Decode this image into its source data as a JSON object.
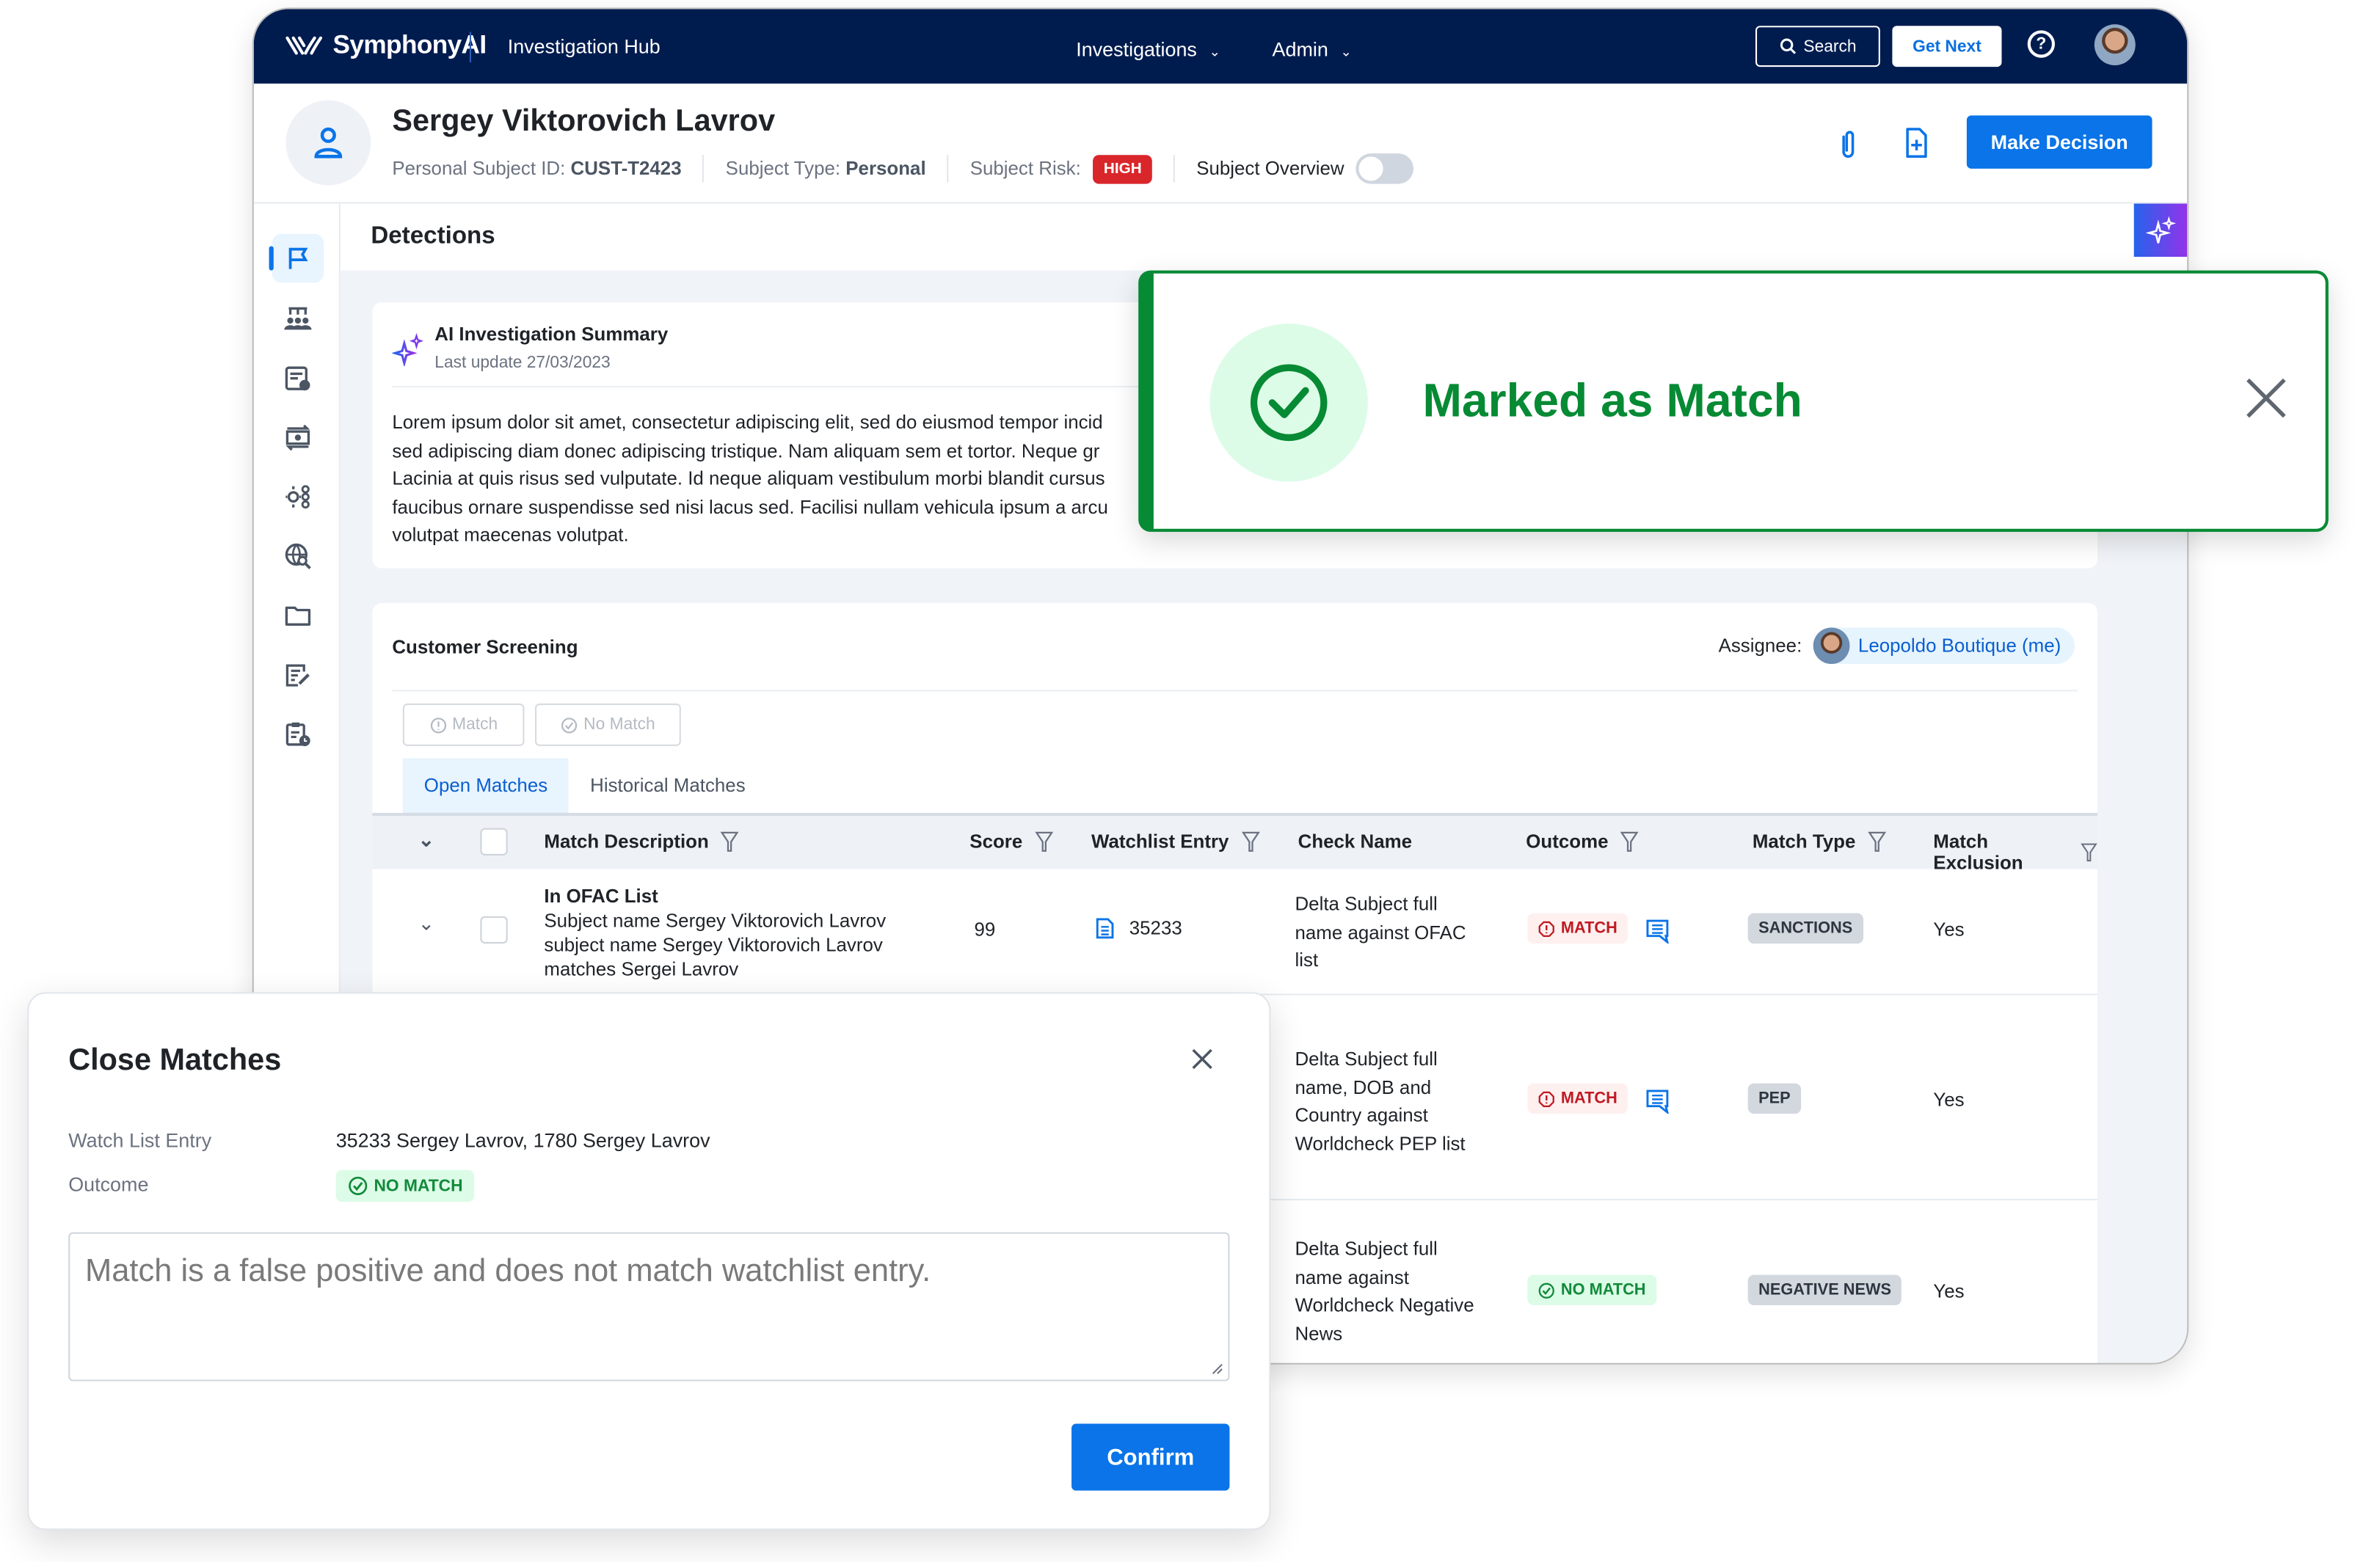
{
  "topbar": {
    "brand": "SymphonyAI",
    "app_name": "Investigation Hub",
    "nav": [
      {
        "label": "Investigations",
        "icon": "chevron-down-icon"
      },
      {
        "label": "Admin",
        "icon": "chevron-down-icon"
      }
    ],
    "search_label": "Search",
    "get_next_label": "Get Next",
    "help_icon": "help-circle-icon",
    "avatar_icon": "user-avatar"
  },
  "subject": {
    "name": "Sergey Viktorovich Lavrov",
    "id_label": "Personal Subject ID:",
    "id_value": "CUST-T2423",
    "type_label": "Subject Type:",
    "type_value": "Personal",
    "risk_label": "Subject Risk:",
    "risk_value": "HIGH",
    "overview_label": "Subject Overview",
    "overview_toggle_on": false,
    "make_decision_label": "Make Decision",
    "colors": {
      "risk_high": "#d9262b",
      "primary": "#0a74e8",
      "topbar": "#001c4f"
    }
  },
  "sidebar": {
    "items": [
      {
        "icon": "flag-icon",
        "active": true
      },
      {
        "icon": "team-icon",
        "active": false
      },
      {
        "icon": "document-info-icon",
        "active": false
      },
      {
        "icon": "transactions-icon",
        "active": false
      },
      {
        "icon": "settings-network-icon",
        "active": false
      },
      {
        "icon": "globe-search-icon",
        "active": false
      },
      {
        "icon": "folder-icon",
        "active": false
      },
      {
        "icon": "notes-edit-icon",
        "active": false
      },
      {
        "icon": "clipboard-clock-icon",
        "active": false
      }
    ]
  },
  "detections": {
    "title": "Detections",
    "ai_summary": {
      "title": "AI Investigation Summary",
      "last_update": "Last update 27/03/2023",
      "body_lines": [
        "Lorem ipsum dolor sit amet, consectetur adipiscing elit, sed do eiusmod tempor incid",
        "sed adipiscing diam donec adipiscing tristique. Nam aliquam sem et tortor. Neque gr",
        "Lacinia at quis risus sed vulputate. Id neque aliquam vestibulum morbi blandit cursus",
        "faucibus ornare suspendisse sed nisi lacus sed. Facilisi nullam vehicula ipsum a arcu",
        "volutpat maecenas volutpat."
      ]
    }
  },
  "screening": {
    "title": "Customer Screening",
    "assignee_label": "Assignee:",
    "assignee_name": "Leopoldo Boutique (me)",
    "action_buttons": [
      {
        "label": "Match",
        "icon": "alert-circle-icon",
        "disabled": true
      },
      {
        "label": "No Match",
        "icon": "check-circle-icon",
        "disabled": true
      }
    ],
    "tabs": [
      {
        "label": "Open Matches",
        "active": true
      },
      {
        "label": "Historical Matches",
        "active": false
      }
    ],
    "columns": [
      "Match Description",
      "Score",
      "Watchlist Entry",
      "Check Name",
      "Outcome",
      "Match Type",
      "Match Exclusion"
    ],
    "rows": [
      {
        "description_title": "In OFAC List",
        "description_lines": [
          "Subject name Sergey Viktorovich Lavrov",
          "subject name Sergey Viktorovich Lavrov",
          "matches Sergei Lavrov"
        ],
        "score": "99",
        "watchlist_entry": "35233",
        "check_name": [
          "Delta Subject full",
          "name against OFAC",
          "list"
        ],
        "outcome": "MATCH",
        "has_comment": true,
        "match_type": "SANCTIONS",
        "match_exclusion": "Yes"
      },
      {
        "description_title": "",
        "description_lines": [],
        "score": "",
        "watchlist_entry": "",
        "check_name": [
          "Delta Subject full",
          "name, DOB and",
          "Country against",
          "Worldcheck PEP list"
        ],
        "outcome": "MATCH",
        "has_comment": true,
        "match_type": "PEP",
        "match_exclusion": "Yes"
      },
      {
        "description_title": "",
        "description_lines": [],
        "score": "",
        "watchlist_entry": "",
        "check_name": [
          "Delta Subject full",
          "name against",
          "Worldcheck Negative",
          "News"
        ],
        "outcome": "NO MATCH",
        "has_comment": false,
        "match_type": "NEGATIVE NEWS",
        "match_exclusion": "Yes"
      }
    ]
  },
  "toast": {
    "message": "Marked as Match",
    "icon": "check-circle-icon",
    "color": "#078a34"
  },
  "dialog": {
    "title": "Close Matches",
    "watch_list_label": "Watch List Entry",
    "watch_list_value": "35233 Sergey Lavrov, 1780 Sergey Lavrov",
    "outcome_label": "Outcome",
    "outcome_value": "NO MATCH",
    "comment_value": "Match is a false positive and does not match watchlist entry.",
    "confirm_label": "Confirm"
  }
}
